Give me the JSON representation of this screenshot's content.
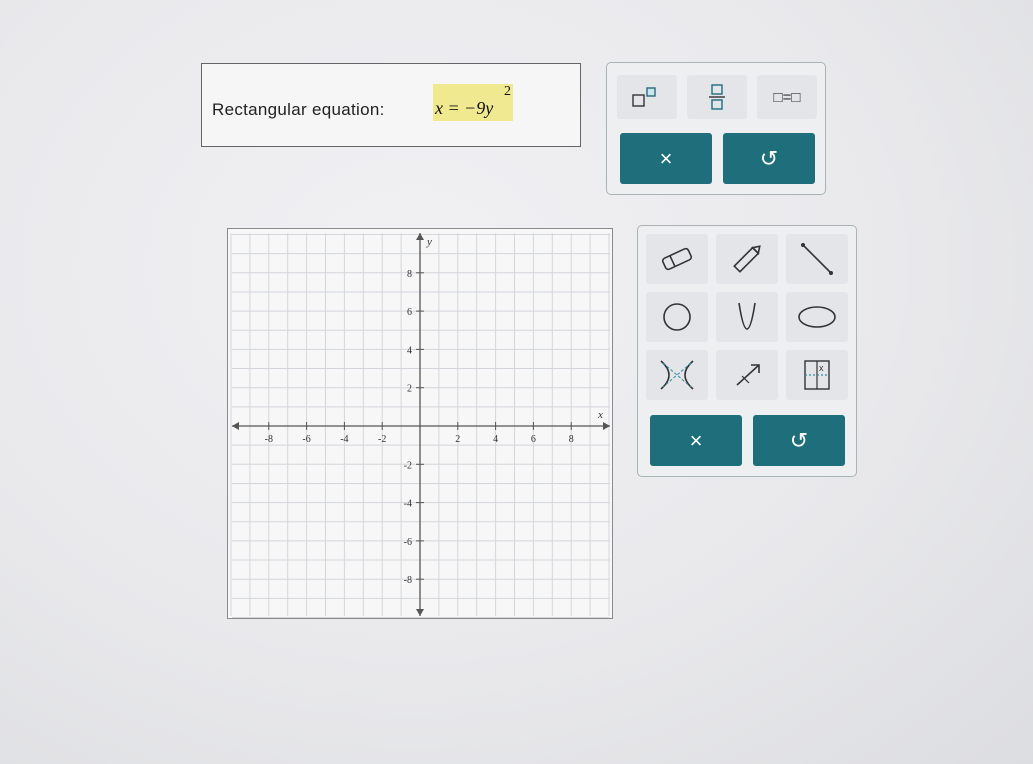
{
  "answer": {
    "label": "Rectangular equation:",
    "equation": "x = −9y",
    "exponent": "2"
  },
  "math_palette": {
    "buttons": [
      {
        "name": "superscript",
        "icon": "superscript-template-icon"
      },
      {
        "name": "fraction",
        "icon": "fraction-template-icon"
      },
      {
        "name": "equals",
        "icon": "equals-template-icon",
        "label": "□=□"
      }
    ],
    "clear_label": "×",
    "undo_label": "↺"
  },
  "tool_palette": {
    "tools": [
      {
        "name": "eraser",
        "icon": "eraser-icon"
      },
      {
        "name": "pencil",
        "icon": "pencil-icon"
      },
      {
        "name": "line",
        "icon": "line-icon"
      },
      {
        "name": "circle",
        "icon": "circle-icon"
      },
      {
        "name": "parabola",
        "icon": "parabola-icon"
      },
      {
        "name": "ellipse",
        "icon": "ellipse-icon"
      },
      {
        "name": "hyperbola",
        "icon": "hyperbola-icon"
      },
      {
        "name": "ray",
        "icon": "ray-icon"
      },
      {
        "name": "point-table",
        "icon": "table-icon"
      }
    ],
    "clear_label": "×",
    "undo_label": "↺"
  },
  "graph": {
    "x_label": "x",
    "y_label": "y",
    "x_ticks": [
      "-8",
      "-6",
      "-4",
      "-2",
      "2",
      "4",
      "6",
      "8"
    ],
    "y_ticks": [
      "8",
      "6",
      "4",
      "2",
      "-2",
      "-4",
      "-6",
      "-8"
    ],
    "x_range": [
      -10,
      10
    ],
    "y_range": [
      -10,
      10
    ],
    "grid": true
  },
  "colors": {
    "accent": "#1e6e7c",
    "highlight": "#f1e98f"
  }
}
